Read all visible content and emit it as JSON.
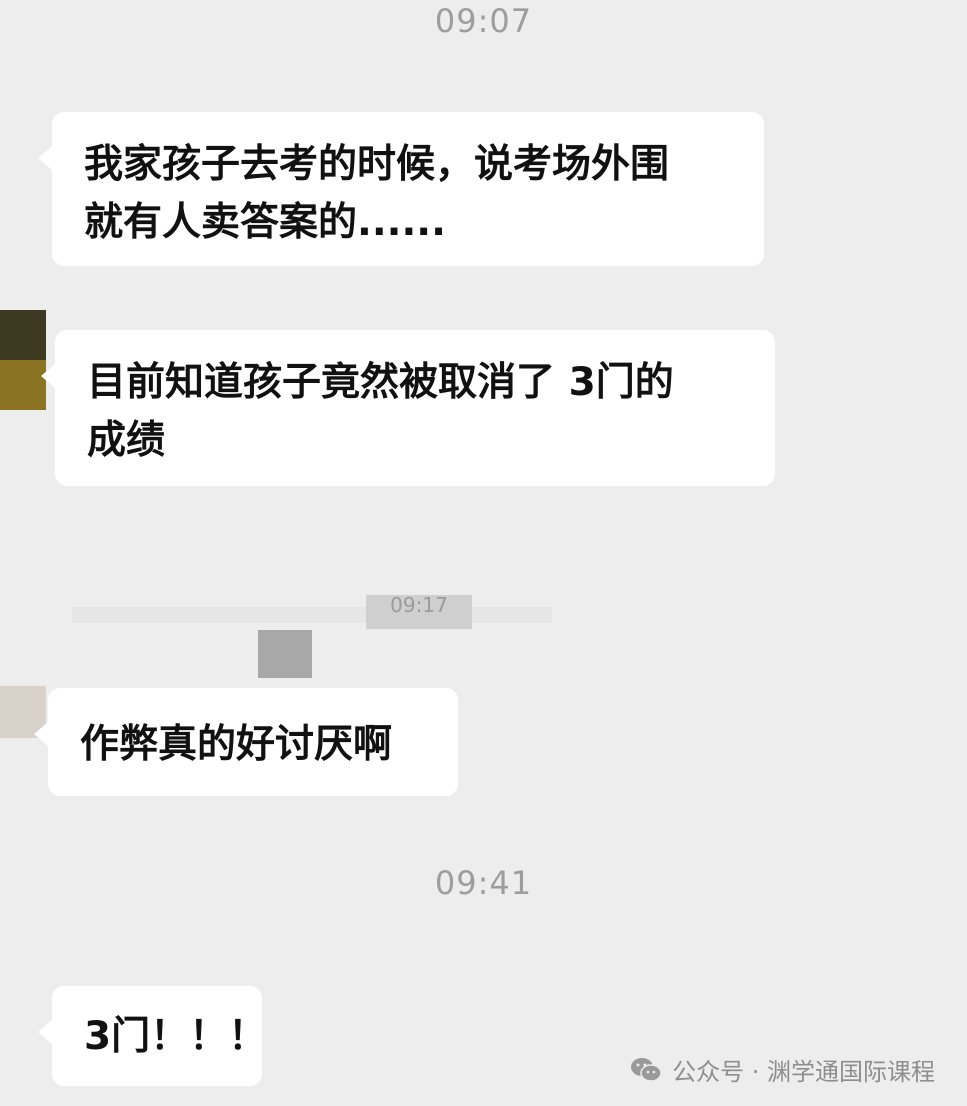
{
  "timestamps": [
    "09:07",
    "09:41"
  ],
  "blurred_timestamp": "09:17",
  "messages": [
    {
      "lines": [
        "我家孩子去考的时候，说考场外围",
        "就有人卖答案的......"
      ]
    },
    {
      "lines": [
        "目前知道孩子竟然被取消了 3门的",
        "成绩"
      ]
    },
    {
      "lines": [
        "作弊真的好讨厌啊"
      ]
    },
    {
      "lines": [
        "3门！！！"
      ]
    }
  ],
  "watermark": {
    "icon": "wechat-icon",
    "text": "公众号 · 渊学通国际课程"
  },
  "colors": {
    "background": "#ededed",
    "bubble": "#ffffff",
    "timestamp": "#9d9d9d",
    "watermark": "#8e8e8e"
  }
}
